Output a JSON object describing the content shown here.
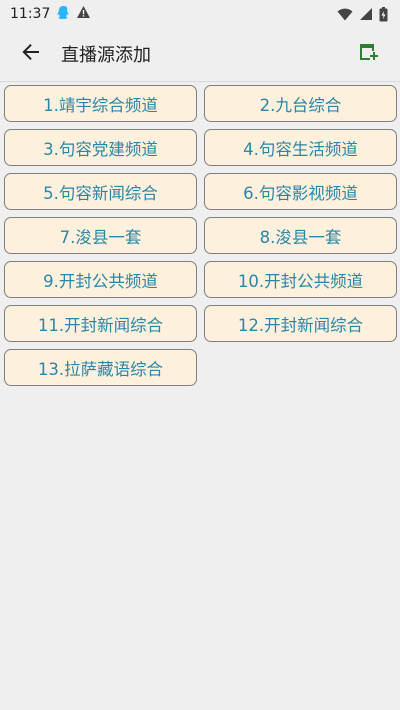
{
  "status_bar": {
    "time": "11:37",
    "left_icons": [
      "qq-icon",
      "warning-icon"
    ],
    "right_icons": [
      "wifi-icon",
      "signal-icon",
      "battery-icon"
    ]
  },
  "app_bar": {
    "title": "直播源添加",
    "back_icon": "arrow-left-icon",
    "action_icon": "add-playlist-icon",
    "accent_color": "#2e7d32"
  },
  "colors": {
    "chip_background": "#fdf1dd",
    "chip_text": "#2a86a8",
    "chip_border": "#7f7f7f",
    "page_background": "#efefef"
  },
  "channels": [
    "1.靖宇综合频道",
    "2.九台综合",
    "3.句容党建频道",
    "4.句容生活频道",
    "5.句容新闻综合",
    "6.句容影视频道",
    "7.浚县一套",
    "8.浚县一套",
    "9.开封公共频道",
    "10.开封公共频道",
    "11.开封新闻综合",
    "12.开封新闻综合",
    "13.拉萨藏语综合"
  ]
}
